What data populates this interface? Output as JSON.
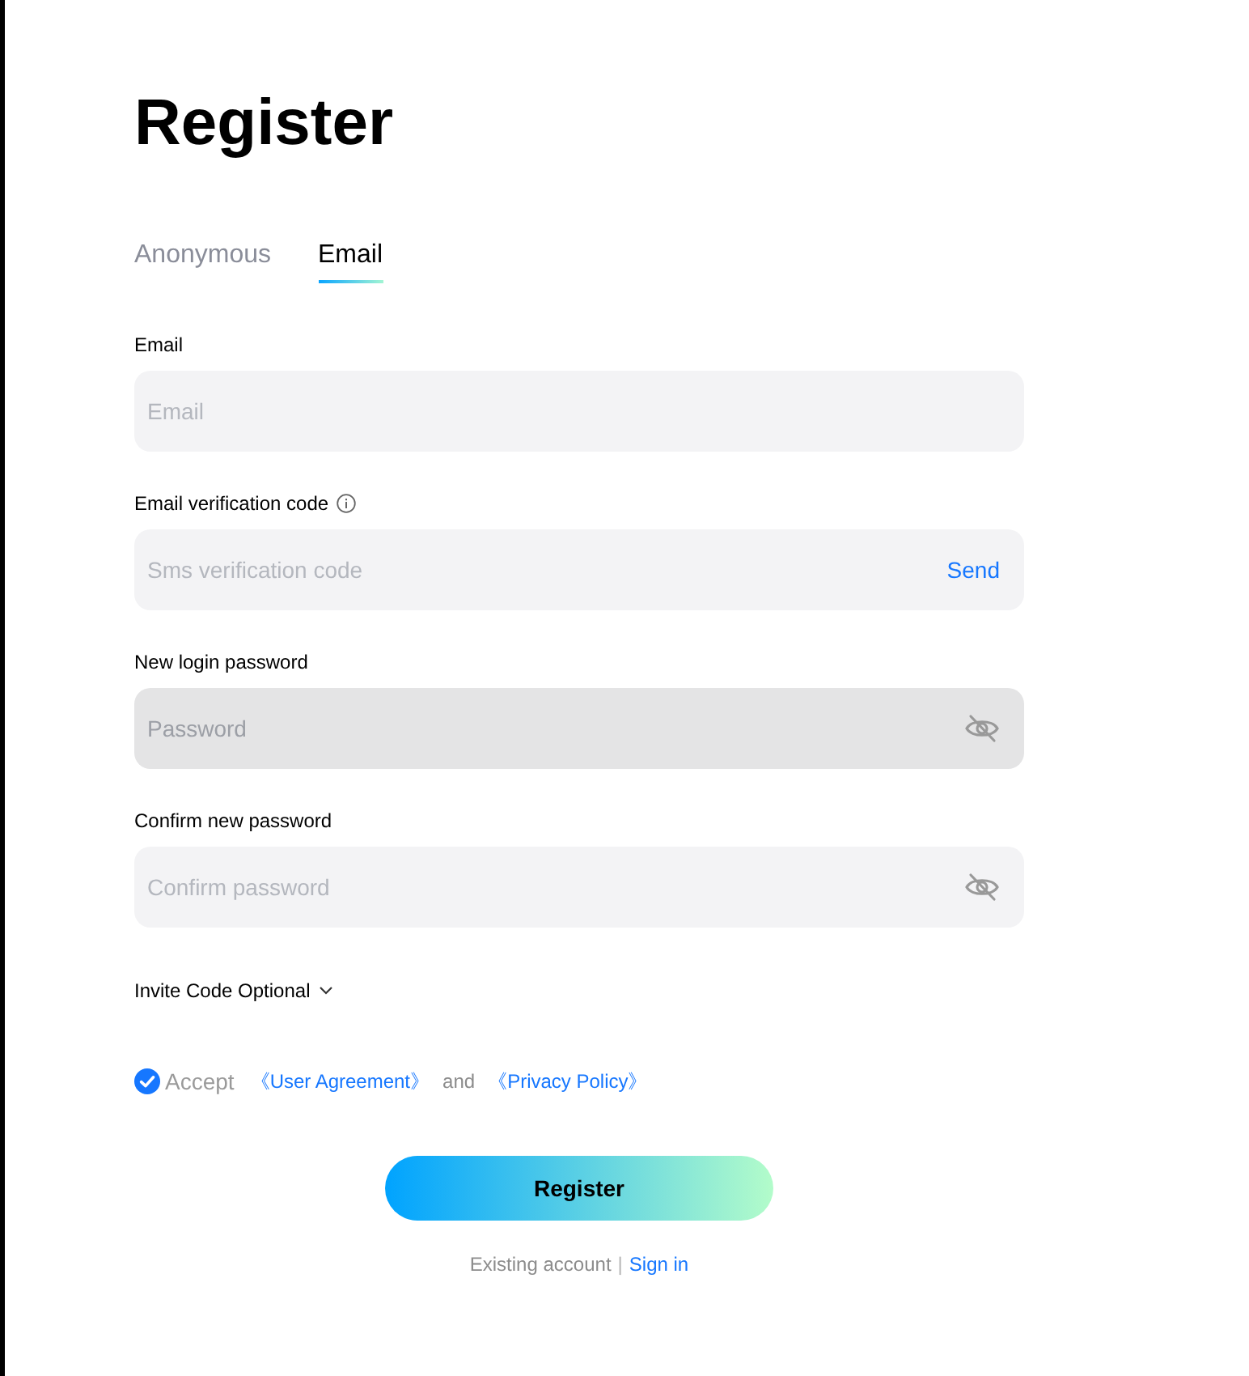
{
  "title": "Register",
  "tabs": [
    {
      "label": "Anonymous",
      "selected": false
    },
    {
      "label": "Email",
      "selected": true
    }
  ],
  "fields": [
    {
      "kind": "email",
      "label": "Email",
      "placeholder": "Email",
      "focused": false
    },
    {
      "kind": "code",
      "label": "Email verification code",
      "info": true,
      "placeholder": "Sms verification code",
      "action": "Send",
      "focused": false
    },
    {
      "kind": "password",
      "label": "New login password",
      "placeholder": "Password",
      "focused": true,
      "revealed": false
    },
    {
      "kind": "password",
      "label": "Confirm new password",
      "placeholder": "Confirm password",
      "focused": false,
      "revealed": false
    }
  ],
  "invite": {
    "label": "Invite Code Optional",
    "expanded": false
  },
  "agreement": {
    "checked": true,
    "label": "Accept",
    "parts": [
      {
        "kind": "link",
        "text": "《User Agreement》"
      },
      {
        "kind": "text",
        "text": "and"
      },
      {
        "kind": "link",
        "text": "《Privacy Policy》"
      }
    ]
  },
  "submit": "Register",
  "footer": {
    "prompt": "Existing account",
    "separator": "|",
    "link": "Sign in"
  }
}
